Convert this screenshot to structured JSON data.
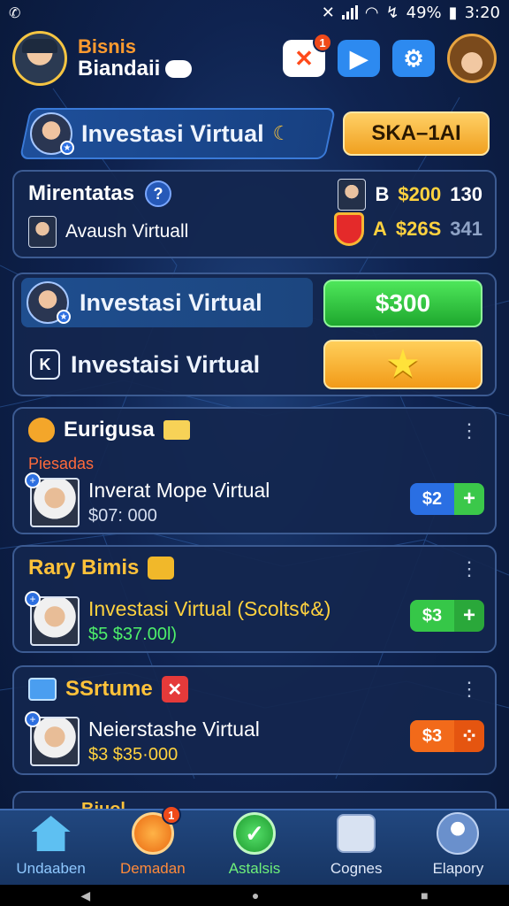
{
  "status": {
    "left": "✆",
    "battery": "49%",
    "battery_prefix": "↯",
    "time": "3:20"
  },
  "header": {
    "brand_line1": "Bisnis",
    "brand_line2": "Biandaii",
    "tools_badge": "1"
  },
  "banner": {
    "title": "Investasi Virtual",
    "button": "SKA–1AI"
  },
  "info": {
    "row1_label": "Mirentatas",
    "row2_label": "Avaush Virtuall",
    "stat1_letter": "B",
    "stat1_amount": "$200",
    "stat1_extra": "130",
    "stat2_letter": "A",
    "stat2_amount": "$26S",
    "stat2_extra": "341"
  },
  "action": {
    "row1_label": "Investasi Virtual",
    "row1_button": "$300",
    "row2_label": "Investaisi Virtual"
  },
  "cards": [
    {
      "title": "Eurigusa",
      "title_color": "#ffffff",
      "subtitle": "Piesadas",
      "name": "Inverat Mope Virtual",
      "amount": "$07: 000",
      "name_color": "#ffffff",
      "amount_color": "#d5def0",
      "pill": "$2",
      "pill_plus": "+"
    },
    {
      "title": "Rary Bimis",
      "title_color": "#ffc23a",
      "subtitle": "",
      "name": "Investasi Virtual (Scolts¢&)",
      "amount": "$5 $37.00l)",
      "name_color": "#ffd23f",
      "amount_color": "#4ef06a",
      "pill": "$3",
      "pill_plus": "+"
    },
    {
      "title": "SSrtume",
      "title_color": "#ffc23a",
      "subtitle": "",
      "name": "Neierstashe Virtual",
      "amount": "$3 $35·000",
      "name_color": "#ffffff",
      "amount_color": "#ffd23f",
      "pill": "$3",
      "pill_plus": "⁘"
    }
  ],
  "peek_title": "Biuol",
  "nav": [
    {
      "label": "Undaaben",
      "color": "#8fc8ff"
    },
    {
      "label": "Demadan",
      "color": "#ff8a3a",
      "badge": "1"
    },
    {
      "label": "Astalsis",
      "color": "#6ef07a"
    },
    {
      "label": "Cognes",
      "color": "#dfe8f8"
    },
    {
      "label": "Elapory",
      "color": "#dfe8f8"
    }
  ]
}
